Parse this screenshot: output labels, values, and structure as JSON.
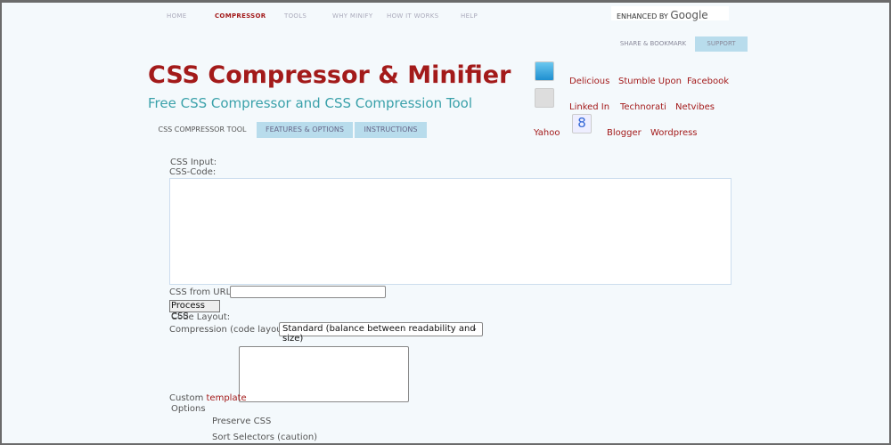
{
  "nav": {
    "items": [
      "HOME",
      "COMPRESSOR",
      "TOOLS",
      "WHY MINIFY",
      "HOW IT WORKS",
      "HELP"
    ],
    "active": "COMPRESSOR"
  },
  "search": {
    "enhanced_by": "ENHANCED BY",
    "brand": "Google"
  },
  "subnav": {
    "share": "SHARE & BOOKMARK",
    "support": "SUPPORT"
  },
  "header": {
    "title": "CSS Compressor & Minifier",
    "subtitle": "Free CSS Compressor and CSS Compression Tool"
  },
  "tabs": [
    "CSS COMPRESSOR TOOL",
    "FEATURES & OPTIONS",
    "INSTRUCTIONS"
  ],
  "social": {
    "delicious": "Delicious",
    "stumble": "Stumble Upon",
    "facebook": "Facebook",
    "linkedin": "Linked In",
    "technorati": "Technorati",
    "netvibes": "Netvibes",
    "yahoo": "Yahoo",
    "blogger": "Blogger",
    "wordpress": "Wordpress"
  },
  "form": {
    "css_input": "CSS Input:",
    "css_code": "CSS-Code:",
    "css_url": "CSS from URL:",
    "url_value": "",
    "process": "Process CSS",
    "code_layout": "Code Layout:",
    "compression_label": "Compression (code layout):",
    "compression_value": "Standard (balance between readability and size)",
    "custom": "Custom",
    "template": "template",
    "options": "Options",
    "preserve": "Preserve CSS",
    "sort": "Sort Selectors (caution)"
  },
  "colors": {
    "accent": "#a31a1a",
    "subtitle": "#3aa1aa",
    "tab_inactive": "#b8dcec"
  }
}
